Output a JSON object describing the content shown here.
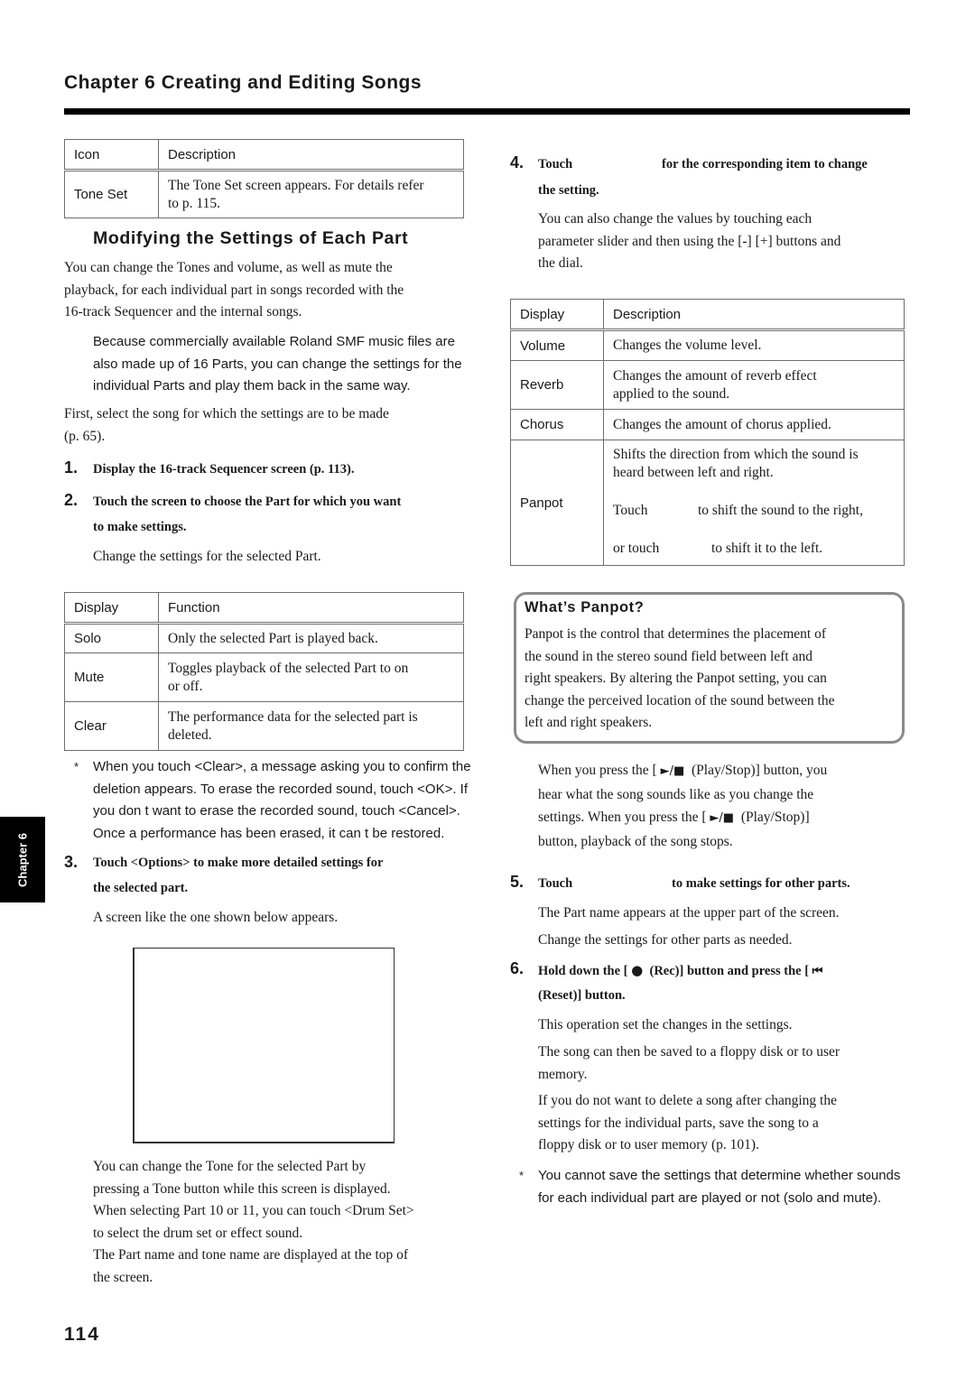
{
  "header": {
    "chapter_title": "Chapter 6 Creating and Editing Songs"
  },
  "icon_table": {
    "headers": [
      "Icon",
      "Description"
    ],
    "rows": [
      {
        "label": "Tone Set",
        "desc_line1": "The Tone Set screen appears. For details refer",
        "desc_line2": "to p. 115."
      }
    ]
  },
  "section": {
    "title": "Modifying the Settings of Each Part",
    "intro": [
      "You can change the Tones and volume, as well as mute the",
      "playback, for each individual part in songs recorded with the",
      "16-track Sequencer and the internal songs."
    ],
    "smf_note": [
      "Because commercially available Roland SMF music files are",
      "also made up of 16 Parts, you can change the settings for the",
      "individual Parts and play them back in the same way."
    ],
    "first_select": [
      "First, select the song for which the settings are to be made",
      "(p. 65)."
    ]
  },
  "steps": {
    "s1": {
      "num": "1.",
      "text": "Display the 16-track Sequencer screen (p. 113)."
    },
    "s2": {
      "num": "2.",
      "line1": "Touch the screen to choose the Part for which you want",
      "line2": "to make settings.",
      "sub": "Change the settings for the selected Part."
    },
    "s3": {
      "num": "3.",
      "line1": "Touch <Options> to make more detailed settings for",
      "line2": "the selected part.",
      "sub": "A screen like the one shown below appears."
    },
    "s4": {
      "num": "4.",
      "touch": "Touch",
      "line1_rest": "for the corresponding item to change",
      "line2": "the setting.",
      "sub": [
        "You can also change the values by touching each",
        "parameter slider and then using the [-] [+] buttons and",
        "the dial."
      ]
    },
    "s5": {
      "num": "5.",
      "touch": "Touch",
      "rest": "to make settings for other parts.",
      "sub1": "The Part name appears at the upper part of the screen.",
      "sub2": "Change the settings for other parts as needed."
    },
    "s6": {
      "num": "6.",
      "line1_a": "Hold down the [",
      "rec_glyph": "●",
      "line1_b": "(Rec)] button and press the [",
      "reset_glyph": "⏮",
      "line2": "(Reset)] button.",
      "sub1": "This operation set the changes in the settings.",
      "sub2": [
        "The song can then be saved to a floppy disk or to user",
        "memory."
      ],
      "sub3": [
        "If you do not want to delete a song after changing the",
        "settings for the individual parts, save the song to a",
        "floppy disk or to user memory (p. 101)."
      ]
    }
  },
  "function_table": {
    "headers": [
      "Display",
      "Function"
    ],
    "rows": [
      {
        "label": "Solo",
        "l1": "Only the selected Part is played back.",
        "l2": ""
      },
      {
        "label": "Mute",
        "l1": "Toggles playback of the selected Part to on",
        "l2": "or off."
      },
      {
        "label": "Clear",
        "l1": "The performance data for the selected part is",
        "l2": "deleted."
      }
    ]
  },
  "clear_note": {
    "star": "*",
    "lines": [
      "When you touch <Clear>, a message asking you to confirm the",
      "deletion appears. To erase the recorded sound, touch <OK>. If",
      "you don t want to erase the recorded sound, touch <Cancel>.",
      "Once a performance has been erased, it can t be restored."
    ]
  },
  "tone_note": [
    "You can change the Tone for the selected Part by",
    "pressing a Tone button while this screen is displayed.",
    "When selecting Part 10 or 11, you can touch <Drum Set>",
    "to select the drum set or effect sound.",
    "The Part name and tone name are displayed at the top of",
    "the screen."
  ],
  "param_table": {
    "headers": [
      "Display",
      "Description"
    ],
    "rows": [
      {
        "label": "Volume",
        "l1": "Changes the volume level.",
        "l2": ""
      },
      {
        "label": "Reverb",
        "l1": "Changes the amount of reverb effect",
        "l2": "applied to the sound."
      },
      {
        "label": "Chorus",
        "l1": "Changes the amount of chorus applied.",
        "l2": ""
      }
    ],
    "panpot": {
      "label": "Panpot",
      "l1": "Shifts the direction from which the sound is",
      "l2": "heard between left and right.",
      "touch_right_a": "Touch",
      "touch_right_b": "to shift the sound to the right,",
      "touch_left_a": "or touch",
      "touch_left_b": "to shift it to the left."
    }
  },
  "info_box": {
    "title": "What’s Panpot?",
    "lines": [
      "Panpot is the control that determines the placement of",
      "the sound in the stereo sound field between left and",
      "right speakers. By altering the Panpot setting, you can",
      "change the perceived location of the sound between the",
      "left and right speakers."
    ]
  },
  "playstop_note": {
    "l1_a": "When you press the [",
    "play_stop_glyph": "►/■",
    "l1_b": "(Play/Stop)] button, you",
    "l2": "hear what the song sounds like as you change the",
    "l3_a": "settings. When you press the [",
    "l3_b": "(Play/Stop)]",
    "l4": "button, playback of the song stops."
  },
  "save_note": {
    "star": "*",
    "lines": [
      "You cannot save the settings that determine whether sounds",
      "for each individual part are played or not (solo and mute)."
    ]
  },
  "side_tab": {
    "label": "Chapter 6"
  },
  "footer": {
    "page_number": "114"
  }
}
